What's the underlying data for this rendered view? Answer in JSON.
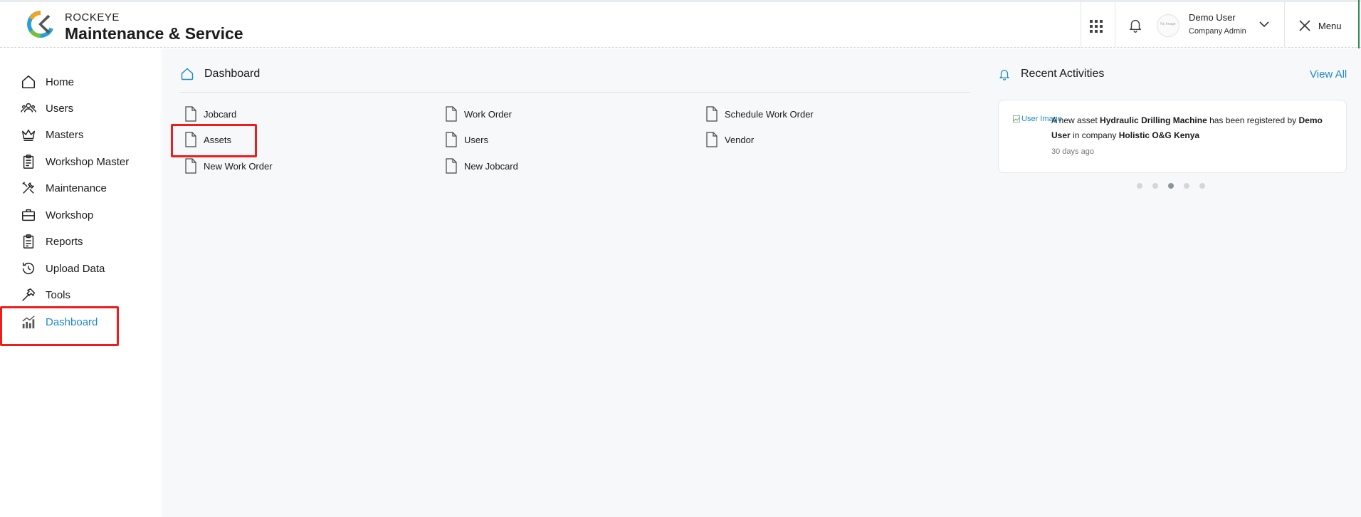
{
  "header": {
    "brand_top": "ROCKEYE",
    "brand_main": "Maintenance & Service",
    "avatar_placeholder": "No Image",
    "user_name": "Demo User",
    "user_role": "Company Admin",
    "menu_label": "Menu"
  },
  "sidebar": {
    "items": [
      {
        "label": "Home",
        "icon": "home-icon"
      },
      {
        "label": "Users",
        "icon": "users-icon"
      },
      {
        "label": "Masters",
        "icon": "crown-icon"
      },
      {
        "label": "Workshop Master",
        "icon": "clipboard-icon"
      },
      {
        "label": "Maintenance",
        "icon": "tools-icon"
      },
      {
        "label": "Workshop",
        "icon": "briefcase-icon"
      },
      {
        "label": "Reports",
        "icon": "report-icon"
      },
      {
        "label": "Upload Data",
        "icon": "history-icon"
      },
      {
        "label": "Tools",
        "icon": "hammer-icon"
      },
      {
        "label": "Dashboard",
        "icon": "chart-icon"
      }
    ],
    "active": "Dashboard"
  },
  "dashboard": {
    "title": "Dashboard",
    "links": [
      [
        "Jobcard",
        "Work Order",
        "Schedule Work Order"
      ],
      [
        "Assets",
        "Users",
        "Vendor"
      ],
      [
        "New Work Order",
        "New Jobcard"
      ]
    ]
  },
  "activities": {
    "title": "Recent Activities",
    "view_all": "View All",
    "img_alt": "User Image",
    "text_a": "A new asset ",
    "asset": "Hydraulic Drilling Machine",
    "text_b": " has been registered by ",
    "user": "Demo User",
    "text_c": " in company ",
    "company": "Holistic O&G Kenya",
    "time": "30 days ago",
    "dots": 5,
    "active_dot": 3
  },
  "colors": {
    "accent": "#1e88c9",
    "highlight": "#ee1c1c"
  }
}
